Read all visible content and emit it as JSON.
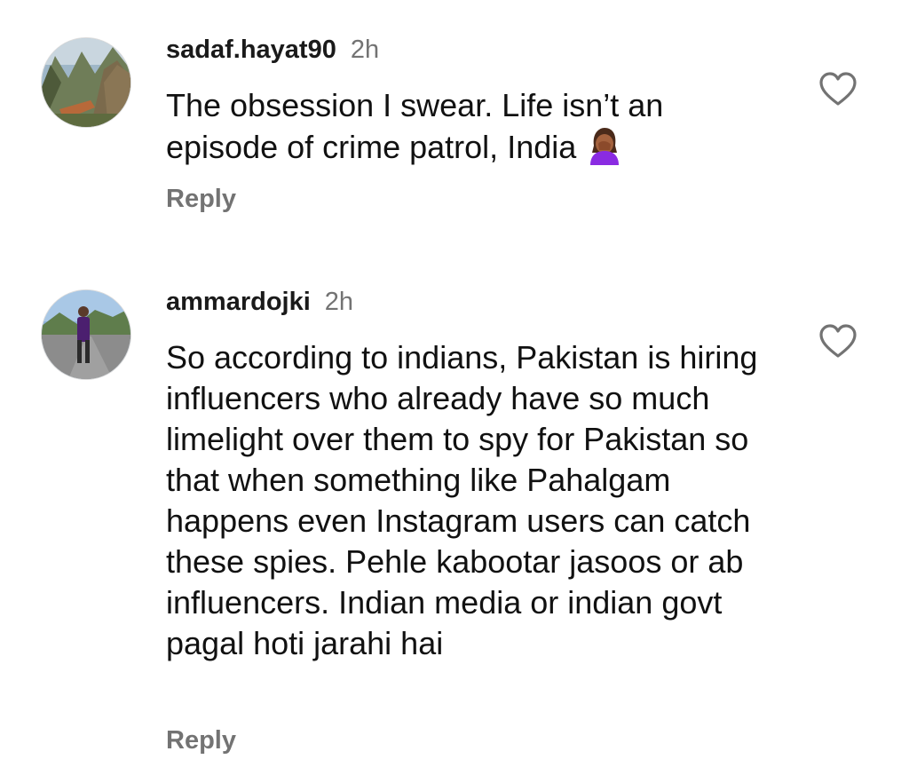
{
  "comments": [
    {
      "username": "sadaf.hayat90",
      "time": "2h",
      "text": "The obsession I swear. Life isn’t an episode of crime patrol, India",
      "emoji": "facepalm-emoji",
      "reply_label": "Reply",
      "like_icon": "heart-outline-icon",
      "avatar": "mountain-landscape-avatar"
    },
    {
      "username": "ammardojki",
      "time": "2h",
      "text": "So according to indians, Pakistan is hiring influencers who already have so much limelight over them to spy for Pakistan so that when something like Pahalgam happens even Instagram users can catch these spies. Pehle kabootar jasoos or ab influencers. Indian media or indian govt pagal hoti jarahi hai",
      "reply_label": "Reply",
      "like_icon": "heart-outline-icon",
      "avatar": "person-on-road-avatar"
    }
  ],
  "colors": {
    "text": "#111111",
    "secondary": "#737373",
    "background": "#ffffff"
  }
}
